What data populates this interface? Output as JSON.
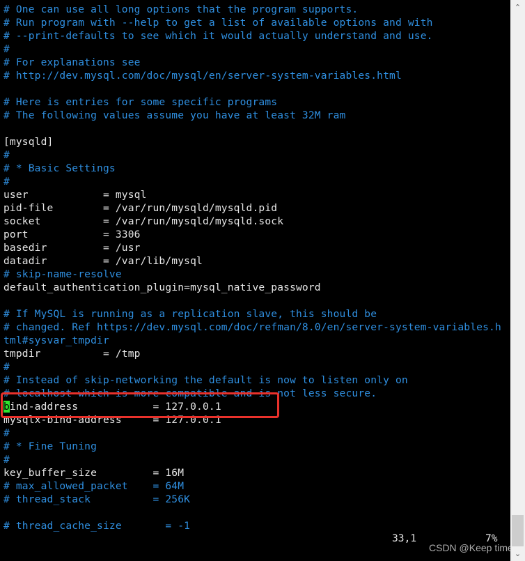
{
  "editor": {
    "lines": [
      {
        "text": "# One can use all long options that the program supports.",
        "kind": "comment"
      },
      {
        "text": "# Run program with --help to get a list of available options and with",
        "kind": "comment"
      },
      {
        "text": "# --print-defaults to see which it would actually understand and use.",
        "kind": "comment"
      },
      {
        "text": "#",
        "kind": "comment"
      },
      {
        "text": "# For explanations see",
        "kind": "comment"
      },
      {
        "text": "# http://dev.mysql.com/doc/mysql/en/server-system-variables.html",
        "kind": "comment"
      },
      {
        "text": "",
        "kind": "normal"
      },
      {
        "text": "# Here is entries for some specific programs",
        "kind": "comment"
      },
      {
        "text": "# The following values assume you have at least 32M ram",
        "kind": "comment"
      },
      {
        "text": "",
        "kind": "normal"
      },
      {
        "text": "[mysqld]",
        "kind": "normal"
      },
      {
        "text": "#",
        "kind": "comment"
      },
      {
        "text": "# * Basic Settings",
        "kind": "comment"
      },
      {
        "text": "#",
        "kind": "comment"
      },
      {
        "text": "user            = mysql",
        "kind": "normal"
      },
      {
        "text": "pid-file        = /var/run/mysqld/mysqld.pid",
        "kind": "normal"
      },
      {
        "text": "socket          = /var/run/mysqld/mysqld.sock",
        "kind": "normal"
      },
      {
        "text": "port            = 3306",
        "kind": "normal"
      },
      {
        "text": "basedir         = /usr",
        "kind": "normal"
      },
      {
        "text": "datadir         = /var/lib/mysql",
        "kind": "normal"
      },
      {
        "text": "# skip-name-resolve",
        "kind": "comment"
      },
      {
        "text": "default_authentication_plugin=mysql_native_password",
        "kind": "normal"
      },
      {
        "text": "",
        "kind": "normal"
      },
      {
        "text": "# If MySQL is running as a replication slave, this should be",
        "kind": "comment"
      },
      {
        "text": "# changed. Ref https://dev.mysql.com/doc/refman/8.0/en/server-system-variables.h",
        "kind": "comment"
      },
      {
        "text": "tml#sysvar_tmpdir",
        "kind": "comment"
      },
      {
        "text": "tmpdir          = /tmp",
        "kind": "normal"
      },
      {
        "text": "#",
        "kind": "comment"
      },
      {
        "text": "# Instead of skip-networking the default is now to listen only on",
        "kind": "comment"
      },
      {
        "text": "# localhost which is more compatible and is not less secure.",
        "kind": "comment"
      },
      {
        "text": "bind-address            = 127.0.0.1",
        "kind": "normal",
        "cursor_col": 0
      },
      {
        "text": "mysqlx-bind-address     = 127.0.0.1",
        "kind": "normal"
      },
      {
        "text": "#",
        "kind": "comment"
      },
      {
        "text": "# * Fine Tuning",
        "kind": "comment"
      },
      {
        "text": "#",
        "kind": "comment"
      },
      {
        "text": "key_buffer_size         = 16M",
        "kind": "normal"
      },
      {
        "text": "# max_allowed_packet    = 64M",
        "kind": "comment"
      },
      {
        "text": "# thread_stack          = 256K",
        "kind": "comment"
      },
      {
        "text": "",
        "kind": "normal"
      },
      {
        "text": "# thread_cache_size       = -1",
        "kind": "comment"
      }
    ],
    "highlighted_line": "bind-address            = 127.0.0.1",
    "colors": {
      "comment": "#2f8fe0",
      "normal": "#e6e6e6",
      "cursor": "#2ee62e",
      "highlight_box": "#e8312b",
      "background": "#000000"
    }
  },
  "status": {
    "cursor_position": "33,1",
    "scroll_percent": "7%"
  },
  "watermark": "CSDN @Keep time",
  "scrollbar": {
    "up_icon": "▲",
    "down_icon": "▼",
    "position_fraction": 0.95
  }
}
